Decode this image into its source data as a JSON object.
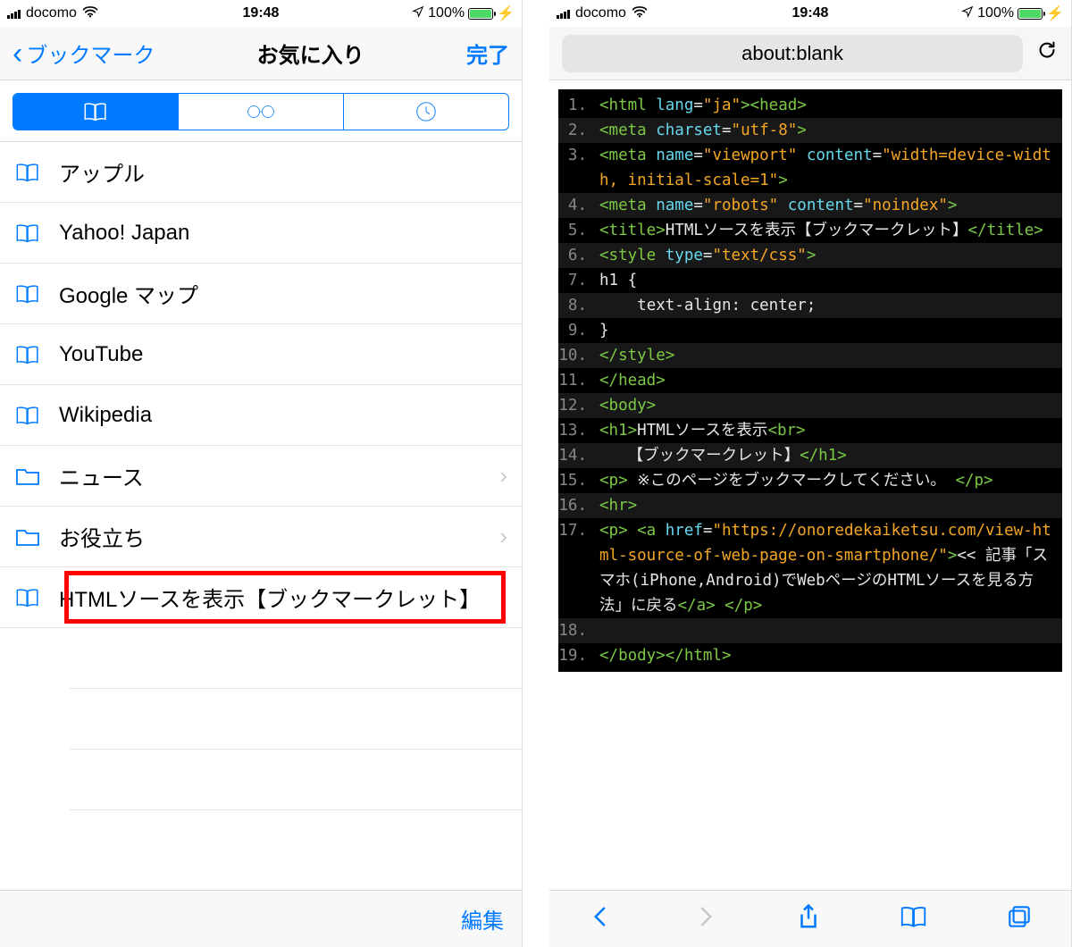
{
  "status": {
    "carrier": "docomo",
    "time": "19:48",
    "battery_pct": "100%"
  },
  "left": {
    "back_label": "ブックマーク",
    "title": "お気に入り",
    "done": "完了",
    "items": [
      {
        "type": "book",
        "label": "アップル"
      },
      {
        "type": "book",
        "label": "Yahoo! Japan"
      },
      {
        "type": "book",
        "label": "Google マップ"
      },
      {
        "type": "book",
        "label": "YouTube"
      },
      {
        "type": "book",
        "label": "Wikipedia"
      },
      {
        "type": "folder",
        "label": "ニュース",
        "chevron": true
      },
      {
        "type": "folder",
        "label": "お役立ち",
        "chevron": true
      },
      {
        "type": "book",
        "label": "HTMLソースを表示【ブックマークレット】",
        "highlight": true
      }
    ],
    "edit": "編集"
  },
  "right": {
    "url": "about:blank",
    "code": [
      {
        "n": "1.",
        "segs": [
          [
            "g",
            "<html "
          ],
          [
            "c",
            "lang"
          ],
          [
            "w",
            "="
          ],
          [
            "o",
            "\"ja\""
          ],
          [
            "g",
            "><head>"
          ]
        ]
      },
      {
        "n": "2.",
        "segs": [
          [
            "g",
            "<meta "
          ],
          [
            "c",
            "charset"
          ],
          [
            "w",
            "="
          ],
          [
            "o",
            "\"utf-8\""
          ],
          [
            "g",
            ">"
          ]
        ]
      },
      {
        "n": "3.",
        "segs": [
          [
            "g",
            "<meta "
          ],
          [
            "c",
            "name"
          ],
          [
            "w",
            "="
          ],
          [
            "o",
            "\"viewport\""
          ],
          [
            "w",
            " "
          ],
          [
            "c",
            "content"
          ],
          [
            "w",
            "="
          ],
          [
            "o",
            "\"width=device-width, initial-scale=1\""
          ],
          [
            "g",
            ">"
          ]
        ]
      },
      {
        "n": "4.",
        "segs": [
          [
            "g",
            "<meta "
          ],
          [
            "c",
            "name"
          ],
          [
            "w",
            "="
          ],
          [
            "o",
            "\"robots\""
          ],
          [
            "w",
            " "
          ],
          [
            "c",
            "content"
          ],
          [
            "w",
            "="
          ],
          [
            "o",
            "\"noindex\""
          ],
          [
            "g",
            ">"
          ]
        ]
      },
      {
        "n": "5.",
        "segs": [
          [
            "g",
            "<title>"
          ],
          [
            "w",
            "HTMLソースを表示【ブックマークレット】"
          ],
          [
            "g",
            "</title>"
          ]
        ]
      },
      {
        "n": "6.",
        "segs": [
          [
            "g",
            "<style "
          ],
          [
            "c",
            "type"
          ],
          [
            "w",
            "="
          ],
          [
            "o",
            "\"text/css\""
          ],
          [
            "g",
            ">"
          ]
        ]
      },
      {
        "n": "7.",
        "segs": [
          [
            "w",
            "h1 {"
          ]
        ]
      },
      {
        "n": "8.",
        "segs": [
          [
            "w",
            "    text-align: center;"
          ]
        ]
      },
      {
        "n": "9.",
        "segs": [
          [
            "w",
            "}"
          ]
        ]
      },
      {
        "n": "10.",
        "segs": [
          [
            "g",
            "</style>"
          ]
        ]
      },
      {
        "n": "11.",
        "segs": [
          [
            "g",
            "</head>"
          ]
        ]
      },
      {
        "n": "12.",
        "segs": [
          [
            "g",
            "<body>"
          ]
        ]
      },
      {
        "n": "13.",
        "segs": [
          [
            "g",
            "<h1>"
          ],
          [
            "w",
            "HTMLソースを表示"
          ],
          [
            "g",
            "<br>"
          ]
        ]
      },
      {
        "n": "14.",
        "segs": [
          [
            "w",
            "   【ブックマークレット】"
          ],
          [
            "g",
            "</h1>"
          ]
        ]
      },
      {
        "n": "15.",
        "segs": [
          [
            "g",
            "<p>"
          ],
          [
            "w",
            " ※このページをブックマークしてください。 "
          ],
          [
            "g",
            "</p>"
          ]
        ]
      },
      {
        "n": "16.",
        "segs": [
          [
            "g",
            "<hr>"
          ]
        ]
      },
      {
        "n": "17.",
        "segs": [
          [
            "g",
            "<p> <a "
          ],
          [
            "c",
            "href"
          ],
          [
            "w",
            "="
          ],
          [
            "o",
            "\"https://onoredekaiketsu.com/view-html-source-of-web-page-on-smartphone/\""
          ],
          [
            "g",
            ">"
          ],
          [
            "w",
            "<< 記事「スマホ(iPhone,Android)でWebページのHTMLソースを見る方法」に戻る"
          ],
          [
            "g",
            "</a> </p>"
          ]
        ]
      },
      {
        "n": "18.",
        "segs": [
          [
            "w",
            " "
          ]
        ]
      },
      {
        "n": "19.",
        "segs": [
          [
            "g",
            "</body></html>"
          ]
        ]
      }
    ]
  }
}
